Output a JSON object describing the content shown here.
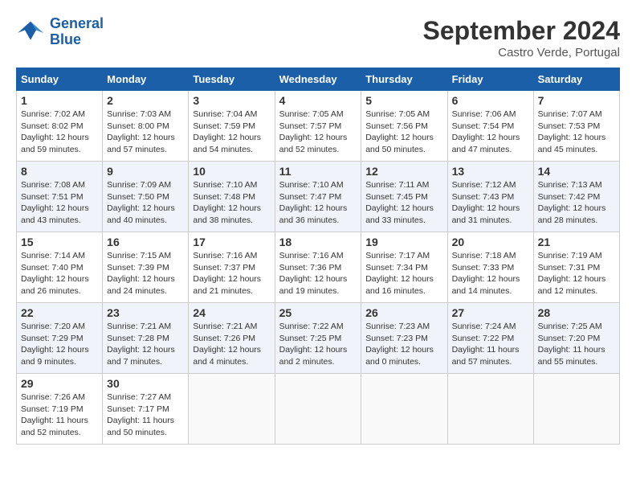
{
  "header": {
    "logo_line1": "General",
    "logo_line2": "Blue",
    "month": "September 2024",
    "location": "Castro Verde, Portugal"
  },
  "columns": [
    "Sunday",
    "Monday",
    "Tuesday",
    "Wednesday",
    "Thursday",
    "Friday",
    "Saturday"
  ],
  "weeks": [
    [
      {
        "day": "1",
        "sunrise": "7:02 AM",
        "sunset": "8:02 PM",
        "daylight": "12 hours and 59 minutes."
      },
      {
        "day": "2",
        "sunrise": "7:03 AM",
        "sunset": "8:00 PM",
        "daylight": "12 hours and 57 minutes."
      },
      {
        "day": "3",
        "sunrise": "7:04 AM",
        "sunset": "7:59 PM",
        "daylight": "12 hours and 54 minutes."
      },
      {
        "day": "4",
        "sunrise": "7:05 AM",
        "sunset": "7:57 PM",
        "daylight": "12 hours and 52 minutes."
      },
      {
        "day": "5",
        "sunrise": "7:05 AM",
        "sunset": "7:56 PM",
        "daylight": "12 hours and 50 minutes."
      },
      {
        "day": "6",
        "sunrise": "7:06 AM",
        "sunset": "7:54 PM",
        "daylight": "12 hours and 47 minutes."
      },
      {
        "day": "7",
        "sunrise": "7:07 AM",
        "sunset": "7:53 PM",
        "daylight": "12 hours and 45 minutes."
      }
    ],
    [
      {
        "day": "8",
        "sunrise": "7:08 AM",
        "sunset": "7:51 PM",
        "daylight": "12 hours and 43 minutes."
      },
      {
        "day": "9",
        "sunrise": "7:09 AM",
        "sunset": "7:50 PM",
        "daylight": "12 hours and 40 minutes."
      },
      {
        "day": "10",
        "sunrise": "7:10 AM",
        "sunset": "7:48 PM",
        "daylight": "12 hours and 38 minutes."
      },
      {
        "day": "11",
        "sunrise": "7:10 AM",
        "sunset": "7:47 PM",
        "daylight": "12 hours and 36 minutes."
      },
      {
        "day": "12",
        "sunrise": "7:11 AM",
        "sunset": "7:45 PM",
        "daylight": "12 hours and 33 minutes."
      },
      {
        "day": "13",
        "sunrise": "7:12 AM",
        "sunset": "7:43 PM",
        "daylight": "12 hours and 31 minutes."
      },
      {
        "day": "14",
        "sunrise": "7:13 AM",
        "sunset": "7:42 PM",
        "daylight": "12 hours and 28 minutes."
      }
    ],
    [
      {
        "day": "15",
        "sunrise": "7:14 AM",
        "sunset": "7:40 PM",
        "daylight": "12 hours and 26 minutes."
      },
      {
        "day": "16",
        "sunrise": "7:15 AM",
        "sunset": "7:39 PM",
        "daylight": "12 hours and 24 minutes."
      },
      {
        "day": "17",
        "sunrise": "7:16 AM",
        "sunset": "7:37 PM",
        "daylight": "12 hours and 21 minutes."
      },
      {
        "day": "18",
        "sunrise": "7:16 AM",
        "sunset": "7:36 PM",
        "daylight": "12 hours and 19 minutes."
      },
      {
        "day": "19",
        "sunrise": "7:17 AM",
        "sunset": "7:34 PM",
        "daylight": "12 hours and 16 minutes."
      },
      {
        "day": "20",
        "sunrise": "7:18 AM",
        "sunset": "7:33 PM",
        "daylight": "12 hours and 14 minutes."
      },
      {
        "day": "21",
        "sunrise": "7:19 AM",
        "sunset": "7:31 PM",
        "daylight": "12 hours and 12 minutes."
      }
    ],
    [
      {
        "day": "22",
        "sunrise": "7:20 AM",
        "sunset": "7:29 PM",
        "daylight": "12 hours and 9 minutes."
      },
      {
        "day": "23",
        "sunrise": "7:21 AM",
        "sunset": "7:28 PM",
        "daylight": "12 hours and 7 minutes."
      },
      {
        "day": "24",
        "sunrise": "7:21 AM",
        "sunset": "7:26 PM",
        "daylight": "12 hours and 4 minutes."
      },
      {
        "day": "25",
        "sunrise": "7:22 AM",
        "sunset": "7:25 PM",
        "daylight": "12 hours and 2 minutes."
      },
      {
        "day": "26",
        "sunrise": "7:23 AM",
        "sunset": "7:23 PM",
        "daylight": "12 hours and 0 minutes."
      },
      {
        "day": "27",
        "sunrise": "7:24 AM",
        "sunset": "7:22 PM",
        "daylight": "11 hours and 57 minutes."
      },
      {
        "day": "28",
        "sunrise": "7:25 AM",
        "sunset": "7:20 PM",
        "daylight": "11 hours and 55 minutes."
      }
    ],
    [
      {
        "day": "29",
        "sunrise": "7:26 AM",
        "sunset": "7:19 PM",
        "daylight": "11 hours and 52 minutes."
      },
      {
        "day": "30",
        "sunrise": "7:27 AM",
        "sunset": "7:17 PM",
        "daylight": "11 hours and 50 minutes."
      },
      null,
      null,
      null,
      null,
      null
    ]
  ]
}
